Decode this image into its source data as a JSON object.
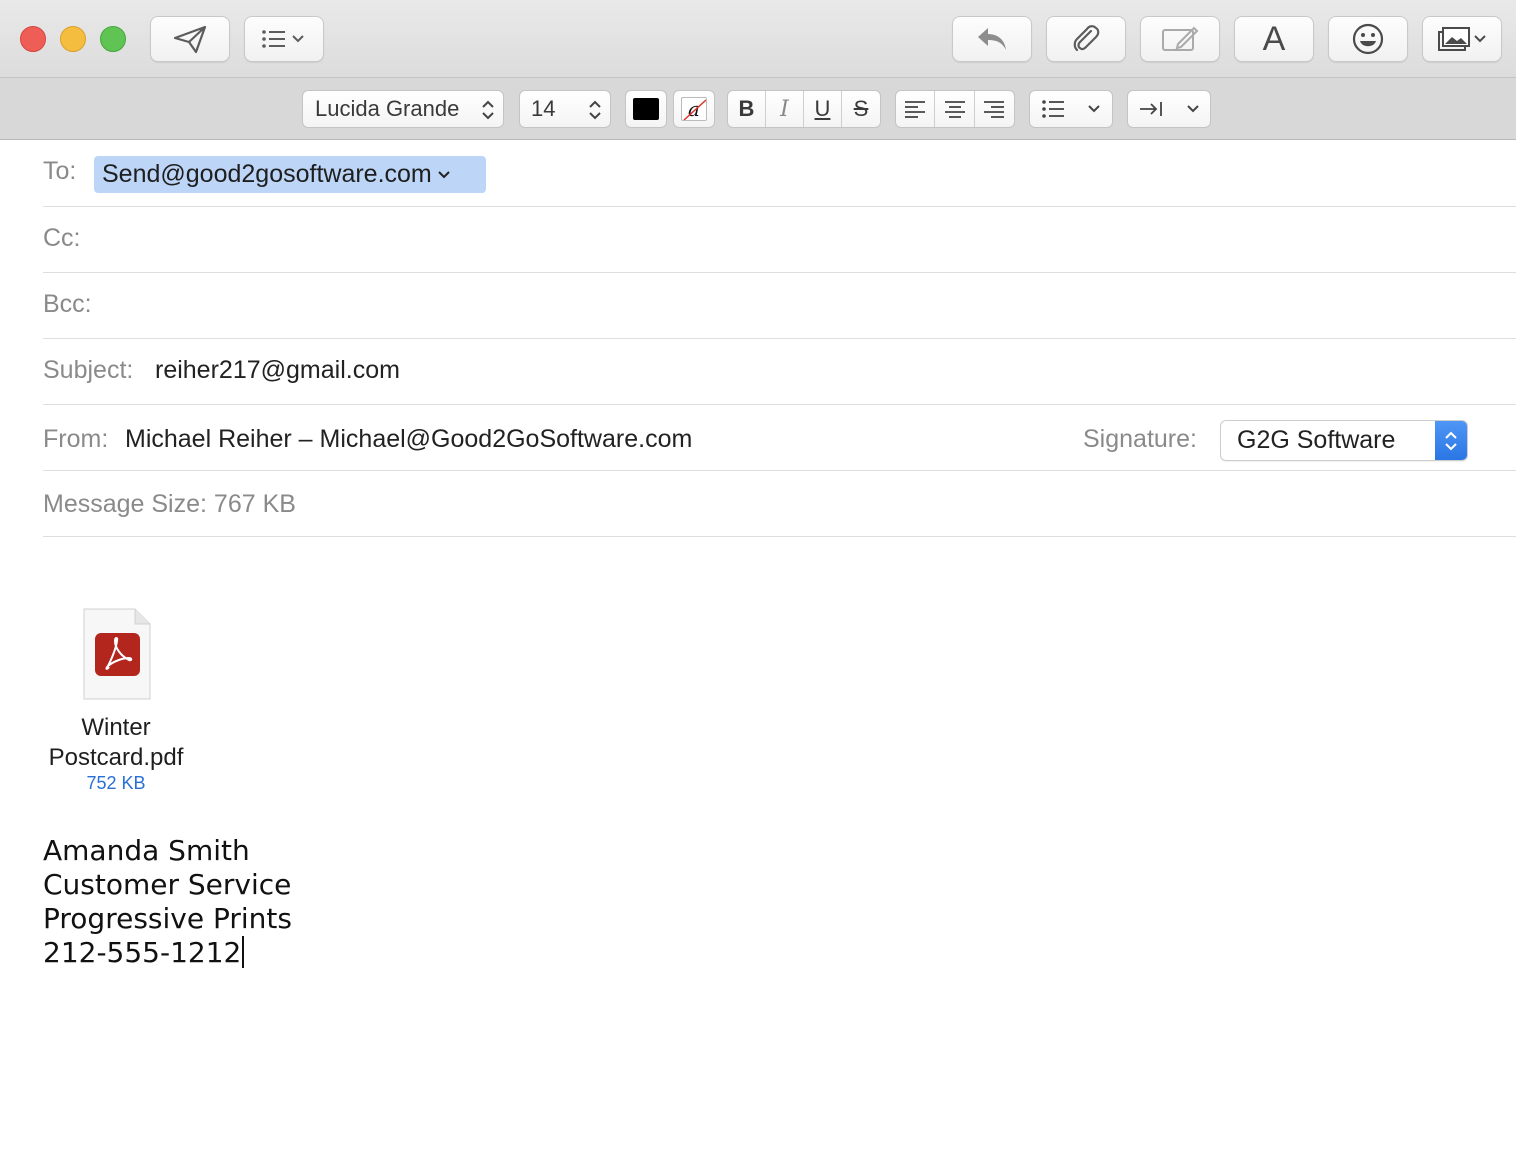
{
  "toolbar": {
    "buttons": [
      {
        "name": "send-button",
        "icon": "paper-plane-icon"
      },
      {
        "name": "header-fields-button",
        "icon": "list-icon"
      },
      {
        "name": "reply-button",
        "icon": "reply-arrow-icon"
      },
      {
        "name": "attach-button",
        "icon": "paperclip-icon"
      },
      {
        "name": "markup-button",
        "icon": "markup-pen-icon"
      },
      {
        "name": "fonts-button",
        "icon": "letter-a-icon"
      },
      {
        "name": "emoji-button",
        "icon": "smiley-icon"
      },
      {
        "name": "photo-browser-button",
        "icon": "photo-icon"
      }
    ],
    "fonts_glyph": "A"
  },
  "format_bar": {
    "font_family": "Lucida Grande",
    "font_size": "14",
    "text_color": "#000000",
    "highlight_glyph": "a",
    "bold": "B",
    "italic": "I",
    "underline": "U",
    "strike": "S"
  },
  "compose": {
    "to_label": "To:",
    "to_value": "Send@good2gosoftware.com",
    "cc_label": "Cc:",
    "bcc_label": "Bcc:",
    "subject_label": "Subject:",
    "subject_value": "reiher217@gmail.com",
    "from_label": "From:",
    "from_value": "Michael Reiher – Michael@Good2GoSoftware.com",
    "signature_label": "Signature:",
    "signature_value": "G2G Software",
    "message_size": "Message Size: 767 KB"
  },
  "attachment": {
    "name_line1": "Winter",
    "name_line2": "Postcard.pdf",
    "size": "752 KB"
  },
  "body": {
    "line1": "Amanda Smith",
    "line2": "Customer Service",
    "line3": "Progressive Prints",
    "line4": "212-555-1212"
  },
  "colors": {
    "close": "#ee5e56",
    "minimize": "#f5bd3f",
    "maximize": "#5fc453",
    "accent_blue": "#2a76e4",
    "pdf_red": "#b3261e",
    "recipient_chip": "#bdd5f7"
  }
}
